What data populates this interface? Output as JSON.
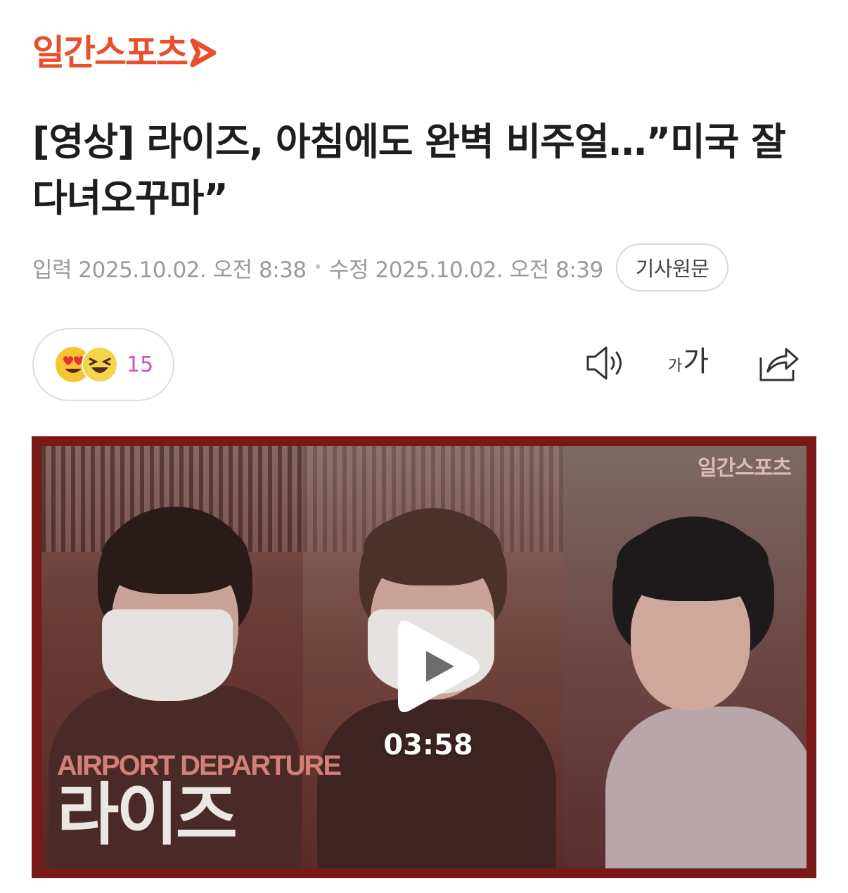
{
  "brand": {
    "name": "일간스포츠",
    "color": "#e8502a"
  },
  "article": {
    "headline": "[영상] 라이즈, 아침에도 완벽 비주얼…”미국 잘 다녀오꾸마”",
    "input_label": "입력",
    "input_time": "2025.10.02. 오전 8:38",
    "edit_label": "수정",
    "edit_time": "2025.10.02. 오전 8:39",
    "origin_button": "기사원문"
  },
  "reactions": {
    "count": "15",
    "icons": [
      "heart-eyes-emoji-icon",
      "laughing-emoji-icon"
    ]
  },
  "tools": {
    "audio_icon": "speaker-icon",
    "font_small": "가",
    "font_big": "가",
    "share_icon": "share-icon"
  },
  "video": {
    "corner_logo": "일간스포츠",
    "overlay_subtitle": "AIRPORT DEPARTURE",
    "overlay_title": "라이즈",
    "duration": "03:58"
  }
}
